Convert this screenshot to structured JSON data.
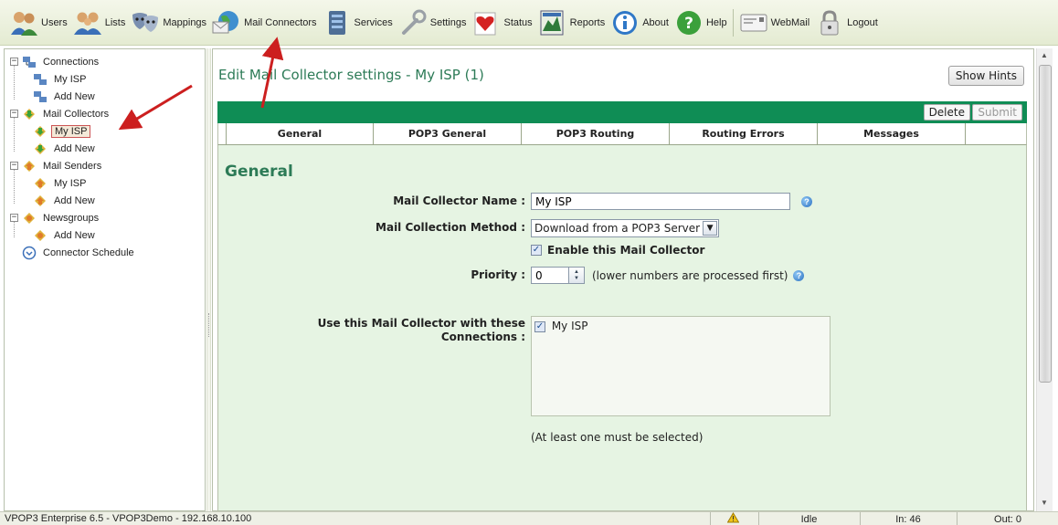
{
  "toolbar": {
    "items": [
      {
        "id": "users",
        "label": "Users",
        "icon": "users-icon"
      },
      {
        "id": "lists",
        "label": "Lists",
        "icon": "lists-icon"
      },
      {
        "id": "mappings",
        "label": "Mappings",
        "icon": "masks-icon"
      },
      {
        "id": "mail-connectors",
        "label": "Mail Connectors",
        "icon": "globe-envelope-icon"
      },
      {
        "id": "services",
        "label": "Services",
        "icon": "server-icon"
      },
      {
        "id": "settings",
        "label": "Settings",
        "icon": "wrench-icon"
      },
      {
        "id": "status",
        "label": "Status",
        "icon": "heart-icon"
      },
      {
        "id": "reports",
        "label": "Reports",
        "icon": "reports-icon"
      },
      {
        "id": "about",
        "label": "About",
        "icon": "info-icon"
      },
      {
        "id": "help",
        "label": "Help",
        "icon": "question-icon"
      },
      {
        "id": "webmail",
        "label": "WebMail",
        "icon": "webmail-icon"
      },
      {
        "id": "logout",
        "label": "Logout",
        "icon": "padlock-icon"
      }
    ]
  },
  "sidebar": {
    "tree": [
      {
        "label": "Connections",
        "level": 0
      },
      {
        "label": "My ISP",
        "level": 1
      },
      {
        "label": "Add New",
        "level": 1
      },
      {
        "label": "Mail Collectors",
        "level": 0
      },
      {
        "label": "My ISP",
        "level": 1,
        "selected": true
      },
      {
        "label": "Add New",
        "level": 1
      },
      {
        "label": "Mail Senders",
        "level": 0
      },
      {
        "label": "My ISP",
        "level": 1
      },
      {
        "label": "Add New",
        "level": 1
      },
      {
        "label": "Newsgroups",
        "level": 0
      },
      {
        "label": "Add New",
        "level": 1
      },
      {
        "label": "Connector Schedule",
        "level": 0
      }
    ]
  },
  "main": {
    "title": "Edit Mail Collector settings - My ISP (1)",
    "show_hints": "Show Hints",
    "delete": "Delete",
    "submit": "Submit",
    "tabs": [
      "General",
      "POP3 General",
      "POP3 Routing",
      "Routing Errors",
      "Messages"
    ],
    "section_title": "General",
    "form": {
      "name_label": "Mail Collector Name :",
      "name_value": "My ISP",
      "method_label": "Mail Collection Method :",
      "method_value": "Download from a POP3 Server",
      "enable_label": "Enable this Mail Collector",
      "priority_label": "Priority :",
      "priority_value": "0",
      "priority_note": "(lower numbers are processed first)",
      "connections_label_1": "Use this Mail Collector with these",
      "connections_label_2": "Connections :",
      "connection_item": "My ISP",
      "connections_note": "(At least one must be selected)"
    }
  },
  "statusbar": {
    "text": "VPOP3 Enterprise 6.5 - VPOP3Demo - 192.168.10.100",
    "state": "Idle",
    "in": "In: 46",
    "out": "Out: 0"
  },
  "colors": {
    "accent_green": "#0f8d55",
    "title_green": "#2d7b57",
    "panel_bg": "#e6f4e3",
    "annotation_red": "#cc1f1f"
  }
}
